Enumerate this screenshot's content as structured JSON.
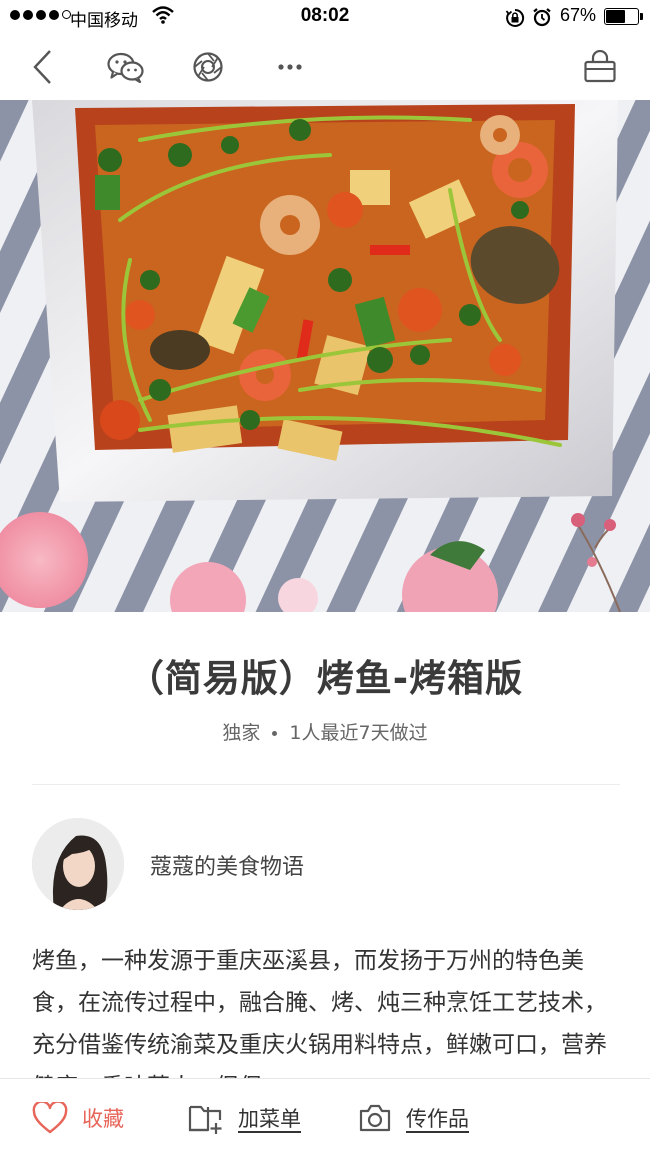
{
  "status_bar": {
    "carrier": "中国移动",
    "time": "08:02",
    "battery": "67%",
    "battery_level": 0.67
  },
  "nav": {
    "icons": [
      "back-icon",
      "wechat-icon",
      "moments-icon",
      "more-icon",
      "basket-icon"
    ]
  },
  "recipe": {
    "title": "（简易版）烤鱼-烤箱版",
    "badge": "独家",
    "cooked": "1人最近7天做过",
    "author": "蔻蔻的美食物语",
    "description": "烤鱼，一种发源于重庆巫溪县，而发扬于万州的特色美食，在流传过程中，融合腌、烤、炖三种烹饪工艺技术，充分借鉴传统渝菜及重庆火锅用料特点，鲜嫩可口，营养健康，香味落人，促保"
  },
  "bottom_bar": {
    "favorite": "收藏",
    "add_menu": "加菜单",
    "upload": "传作品"
  },
  "colors": {
    "accent": "#e8655a",
    "text": "#333333"
  }
}
